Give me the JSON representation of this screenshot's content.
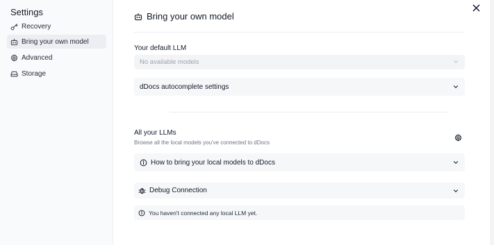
{
  "sidebar": {
    "title": "Settings",
    "items": [
      {
        "label": "Recovery",
        "icon": "key-icon",
        "active": false
      },
      {
        "label": "Bring your own model",
        "icon": "robot-icon",
        "active": true
      },
      {
        "label": "Advanced",
        "icon": "gear-icon",
        "active": false
      },
      {
        "label": "Storage",
        "icon": "drive-icon",
        "active": false
      }
    ]
  },
  "header": {
    "icon": "robot-icon",
    "title": "Bring your own model"
  },
  "default_llm": {
    "label": "Your default LLM",
    "select_value": "No available models",
    "autocomplete_label": "dDocs autocomplete settings"
  },
  "all_llms": {
    "title": "All your LLMs",
    "subtitle": "Browse all the local models you've connected to dDocs",
    "howto_label": "How to bring your local models to dDocs",
    "debug_label": "Debug Connection",
    "notice": "You haven't connected any local LLM yet."
  },
  "colors": {
    "sidebar_bg": "#f9fafb",
    "active_item_bg": "#eceef1",
    "card_bg": "#f6f7f9",
    "muted_text": "#9ca3af"
  }
}
